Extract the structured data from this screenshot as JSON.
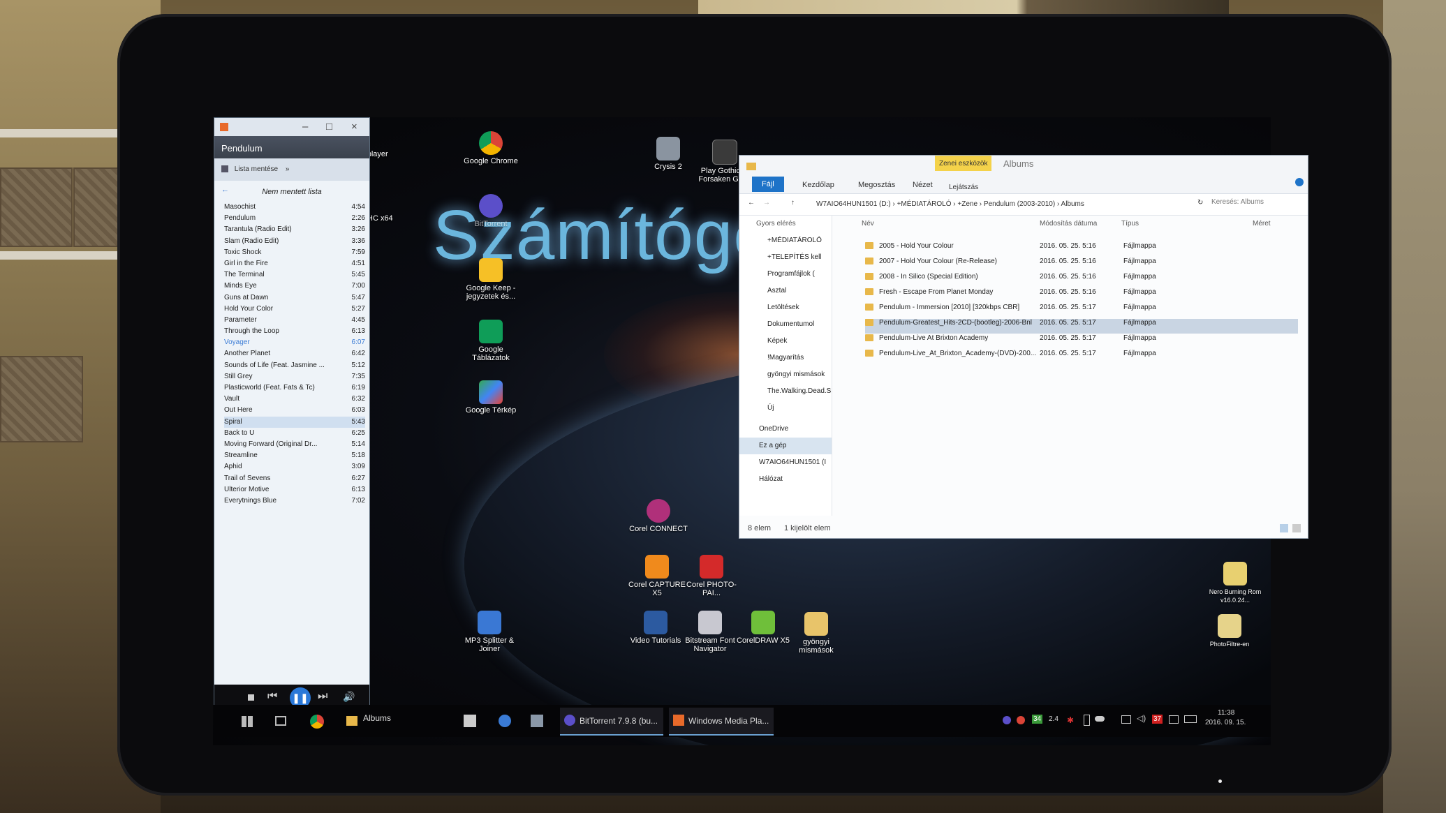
{
  "desktop": {
    "watermark": "Számítógép",
    "icons": [
      {
        "label": "Google Chrome",
        "icon": "chrome-icon"
      },
      {
        "label": "BitTorrent",
        "icon": "bittorrent-icon"
      },
      {
        "label": "Google Keep - jegyzetek és...",
        "icon": "google-keep-icon"
      },
      {
        "label": "Google Táblázatok",
        "icon": "google-sheets-icon"
      },
      {
        "label": "Google Térkép",
        "icon": "google-maps-icon"
      },
      {
        "label": "Crysis 2",
        "icon": "crysis-icon"
      },
      {
        "label": "Play Gothic III Forsaken Gods",
        "icon": "gothic-icon"
      },
      {
        "label": "Corel CONNECT",
        "icon": "corel-connect-icon"
      },
      {
        "label": "Corel CAPTURE X5",
        "icon": "corel-capture-icon"
      },
      {
        "label": "Corel PHOTO-PAI...",
        "icon": "corel-photopaint-icon"
      },
      {
        "label": "MP3 Splitter & Joiner",
        "icon": "mp3-splitter-icon"
      },
      {
        "label": "Video Tutorials",
        "icon": "video-tutorials-icon"
      },
      {
        "label": "Bitstream Font Navigator",
        "icon": "font-navigator-icon"
      },
      {
        "label": "CorelDRAW X5",
        "icon": "coreldraw-icon"
      },
      {
        "label": "gyöngyi mismások",
        "icon": "folder-icon"
      },
      {
        "label": "Nero Burning Rom v16.0.24...",
        "icon": "nero-icon"
      },
      {
        "label": "PhotoFiltre-en",
        "icon": "photofiltre-icon"
      },
      {
        "label": "dia player",
        "icon": "vlc-icon"
      },
      {
        "label": "HC x64",
        "icon": "mpc-icon"
      }
    ]
  },
  "media_player": {
    "title": "Pendulum",
    "save_list": "Lista mentése",
    "list_header": "Nem mentett lista",
    "tracks": [
      {
        "name": "Masochist",
        "time": "4:54"
      },
      {
        "name": "Pendulum",
        "time": "2:26"
      },
      {
        "name": "Tarantula (Radio Edit)",
        "time": "3:26"
      },
      {
        "name": "Slam (Radio Edit)",
        "time": "3:36"
      },
      {
        "name": "Toxic Shock",
        "time": "7:59"
      },
      {
        "name": "Girl in the Fire",
        "time": "4:51"
      },
      {
        "name": "The Terminal",
        "time": "5:45"
      },
      {
        "name": "Minds Eye",
        "time": "7:00"
      },
      {
        "name": "Guns at Dawn",
        "time": "5:47"
      },
      {
        "name": "Hold Your Color",
        "time": "5:27"
      },
      {
        "name": "Parameter",
        "time": "4:45"
      },
      {
        "name": "Through the Loop",
        "time": "6:13"
      },
      {
        "name": "Voyager",
        "time": "6:07"
      },
      {
        "name": "Another Planet",
        "time": "6:42"
      },
      {
        "name": "Sounds of Life (Feat. Jasmine ...",
        "time": "5:12"
      },
      {
        "name": "Still Grey",
        "time": "7:35"
      },
      {
        "name": "Plasticworld (Feat. Fats & Tc)",
        "time": "6:19"
      },
      {
        "name": "Vault",
        "time": "6:32"
      },
      {
        "name": "Out Here",
        "time": "6:03"
      },
      {
        "name": "Spiral",
        "time": "5:43"
      },
      {
        "name": "Back to U",
        "time": "6:25"
      },
      {
        "name": "Moving Forward (Original Dr...",
        "time": "5:14"
      },
      {
        "name": "Streamline",
        "time": "5:18"
      },
      {
        "name": "Aphid",
        "time": "3:09"
      },
      {
        "name": "Trail of Sevens",
        "time": "6:27"
      },
      {
        "name": "Ulterior Motive",
        "time": "6:13"
      },
      {
        "name": "Everytnings Blue",
        "time": "7:02"
      }
    ]
  },
  "explorer": {
    "title": "Albums",
    "context_tab": "Zenei eszközök",
    "tabs": [
      "Fájl",
      "Kezdőlap",
      "Megosztás",
      "Nézet",
      "Lejátszás"
    ],
    "path": [
      "W7AIO64HUN1501 (D:)",
      "+MÉDIATÁROLÓ",
      "+Zene",
      "Pendulum (2003-2010)",
      "Albums"
    ],
    "search_placeholder": "Keresés: Albums",
    "columns": [
      "Név",
      "Módosítás dátuma",
      "Típus",
      "Méret"
    ],
    "nav": [
      "Gyors elérés",
      "+MÉDIATÁROLÓ",
      "+TELEPÍTÉS kell",
      "Programfájlok (",
      "Asztal",
      "Letöltések",
      "Dokumentumol",
      "Képek",
      "!Magyarítás",
      "gyöngyi mismások",
      "The.Walking.Dead.S",
      "Új",
      "OneDrive",
      "Ez a gép",
      "W7AIO64HUN1501 (I",
      "Hálózat"
    ],
    "rows": [
      {
        "name": "2005 - Hold Your Colour",
        "date": "2016. 05. 25. 5:16",
        "type": "Fájlmappa"
      },
      {
        "name": "2007 - Hold Your Colour (Re-Release)",
        "date": "2016. 05. 25. 5:16",
        "type": "Fájlmappa"
      },
      {
        "name": "2008 - In Silico (Special Edition)",
        "date": "2016. 05. 25. 5:16",
        "type": "Fájlmappa"
      },
      {
        "name": "Fresh - Escape From Planet Monday",
        "date": "2016. 05. 25. 5:16",
        "type": "Fájlmappa"
      },
      {
        "name": "Pendulum - Immersion [2010] [320kbps CBR]",
        "date": "2016. 05. 25. 5:17",
        "type": "Fájlmappa"
      },
      {
        "name": "Pendulum-Greatest_Hits-2CD-(bootleg)-2006-Bnl",
        "date": "2016. 05. 25. 5:17",
        "type": "Fájlmappa"
      },
      {
        "name": "Pendulum-Live At Brixton Academy",
        "date": "2016. 05. 25. 5:17",
        "type": "Fájlmappa"
      },
      {
        "name": "Pendulum-Live_At_Brixton_Academy-(DVD)-200...",
        "date": "2016. 05. 25. 5:17",
        "type": "Fájlmappa"
      }
    ],
    "status_count": "8 elem",
    "status_selected": "1 kijelölt elem"
  },
  "taskbar": {
    "pinned_albums": "Albums",
    "bittorrent": "BitTorrent 7.9.8 (bu...",
    "wmp": "Windows Media Pla...",
    "tray": {
      "num1": "34",
      "num2": "2.4",
      "num3": "37"
    },
    "time": "11:38",
    "date": "2016. 09. 15."
  }
}
